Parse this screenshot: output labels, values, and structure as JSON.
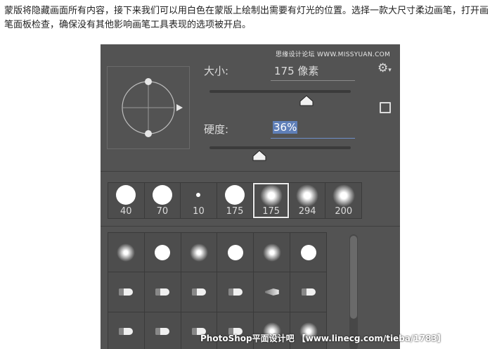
{
  "caption": "蒙版将隐藏画面所有内容，接下来我们可以用白色在蒙版上绘制出需要有灯光的位置。选择一款大尺寸柔边画笔，打开画笔面板检查，确保没有其他影响画笔工具表现的选项被开启。",
  "watermark_top": "思缘设计论坛 WWW.MISSYUAN.COM",
  "watermark_bottom": "PhotoShop平面设计吧 【www.linecg.com/tieba/1783】",
  "brush_panel": {
    "size_label": "大小:",
    "size_value": "175 像素",
    "size_level": 0.69,
    "hardness_label": "硬度:",
    "hardness_value": "36%",
    "hardness_level": 0.36,
    "gear_icon": "gear-icon",
    "new_preset_icon": "page-icon"
  },
  "presets": [
    {
      "label": "40",
      "kind": "hard"
    },
    {
      "label": "70",
      "kind": "hard"
    },
    {
      "label": "10",
      "kind": "hard-small"
    },
    {
      "label": "175",
      "kind": "hard"
    },
    {
      "label": "175",
      "kind": "soft",
      "selected": true
    },
    {
      "label": "294",
      "kind": "soft"
    },
    {
      "label": "200",
      "kind": "soft"
    }
  ],
  "brush_grid": [
    "soft",
    "hard",
    "soft",
    "hard",
    "soft",
    "hard",
    "tip",
    "tip",
    "tip",
    "tip",
    "fan",
    "tip",
    "tip",
    "tip",
    "tip",
    "tip",
    "soft",
    "soft"
  ]
}
